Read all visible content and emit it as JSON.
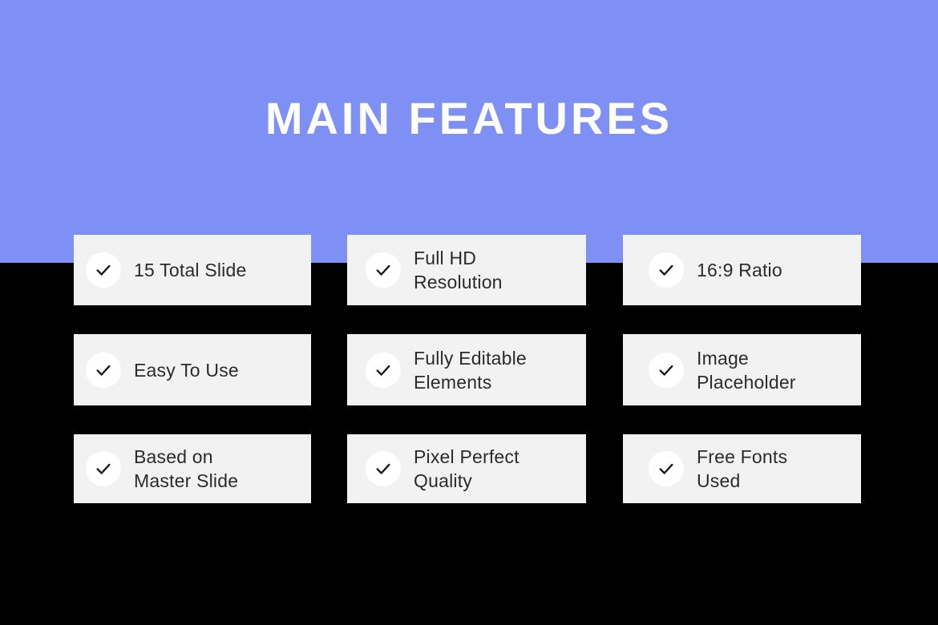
{
  "slide": {
    "title": "MAIN FEATURES",
    "colors": {
      "accent_band": "#7f90f5",
      "background": "#000000",
      "card_background": "#f2f2f2",
      "badge_background": "#ffffff",
      "title_text": "#ffffff",
      "label_text": "#2b2b2b"
    },
    "check_icon": "check-icon"
  },
  "features": [
    {
      "id": "total-slide",
      "lines": [
        "15 Total Slide"
      ]
    },
    {
      "id": "full-hd",
      "lines": [
        "Full HD",
        "Resolution"
      ]
    },
    {
      "id": "ratio",
      "lines": [
        "16:9 Ratio"
      ]
    },
    {
      "id": "easy-to-use",
      "lines": [
        "Easy To Use"
      ]
    },
    {
      "id": "fully-editable",
      "lines": [
        "Fully Editable",
        "Elements"
      ]
    },
    {
      "id": "image-placeholder",
      "lines": [
        "Image",
        "Placeholder"
      ]
    },
    {
      "id": "master-slide",
      "lines": [
        "Based on",
        "Master Slide"
      ]
    },
    {
      "id": "pixel-perfect",
      "lines": [
        "Pixel Perfect",
        "Quality"
      ]
    },
    {
      "id": "free-fonts",
      "lines": [
        "Free Fonts",
        "Used"
      ]
    }
  ]
}
